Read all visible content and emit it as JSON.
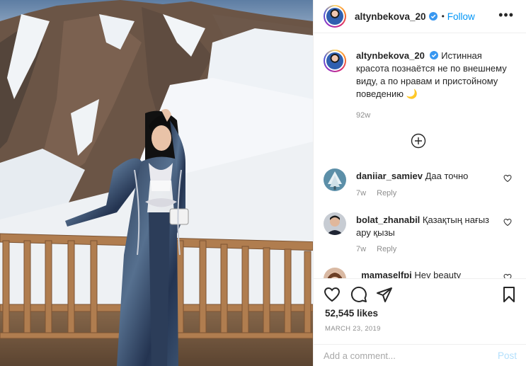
{
  "post": {
    "username": "altynbekova_20",
    "follow_label": "Follow",
    "dot": "•",
    "more_label": "•••",
    "caption": "Истинная красота познаётся не по внешнему виду, а по нравам и пристойному поведению 🌙",
    "caption_time": "92w"
  },
  "comments": [
    {
      "username": "daniiar_samiev",
      "text": "Даа точно",
      "time": "7w",
      "reply": "Reply"
    },
    {
      "username": "bolat_zhanabil",
      "text": "Қазақтың нағыз ару қызы",
      "time": "7w",
      "reply": "Reply"
    },
    {
      "username": "_mamaselfpi",
      "text": "Hey beauty"
    }
  ],
  "actions": {
    "likes": "52,545 likes",
    "date": "MARCH 23, 2019",
    "comment_placeholder": "Add a comment...",
    "post_label": "Post"
  },
  "colors": {
    "accent": "#0095f6",
    "verified": "#3897f0",
    "muted": "#8e8e8e"
  },
  "icons": [
    "heart-icon",
    "comment-icon",
    "share-icon",
    "bookmark-icon",
    "plus-circle-icon",
    "verified-icon",
    "more-icon"
  ]
}
